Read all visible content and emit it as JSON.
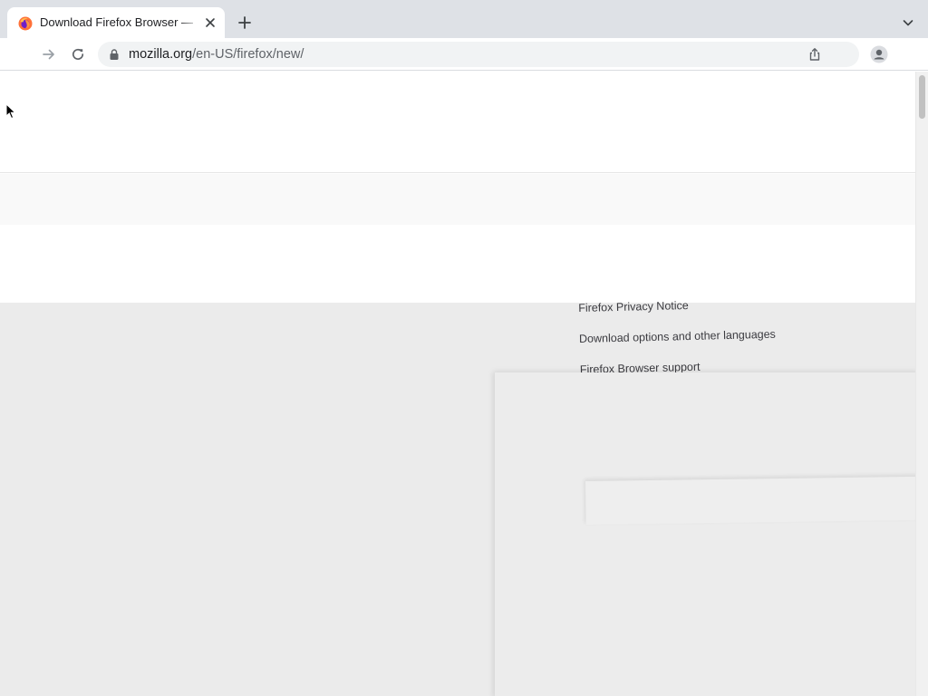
{
  "browser": {
    "tab": {
      "title": "Download Firefox Browser — Fast, Private & Free — from Mozilla",
      "favicon": "firefox-logo-icon",
      "close_icon": "close-icon"
    },
    "new_tab_icon": "plus-icon",
    "tab_search_icon": "chevron-down-icon",
    "toolbar": {
      "forward_icon": "arrow-right-icon",
      "reload_icon": "reload-icon",
      "address": {
        "host": "mozilla.org",
        "path": "/en-US/firefox/new/",
        "lock_icon": "lock-icon"
      },
      "share_icon": "share-icon",
      "profile_icon": "profile-icon"
    }
  },
  "page": {
    "links": [
      "Firefox Privacy Notice",
      "Download options and other languages",
      "Firefox Browser support"
    ]
  },
  "colors": {
    "tabstrip": "#dee1e6",
    "omnibox": "#f1f3f4",
    "overlay": "#ebebeb"
  }
}
